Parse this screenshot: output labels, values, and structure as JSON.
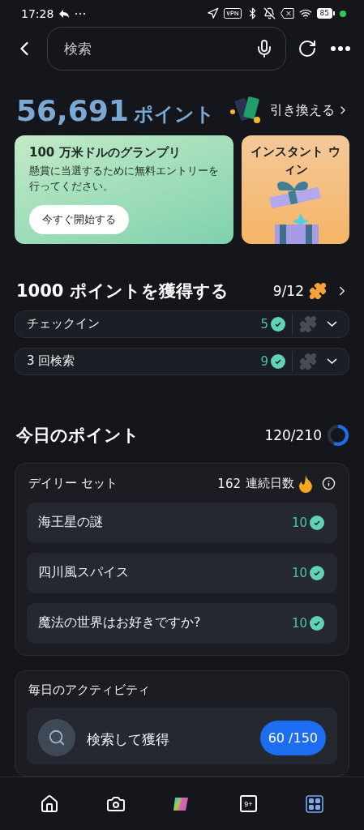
{
  "status_bar": {
    "time": "17:28",
    "battery": "85"
  },
  "search": {
    "placeholder": "検索"
  },
  "points": {
    "value": "56,691",
    "unit": "ポイント",
    "redeem": "引き換える"
  },
  "promos": [
    {
      "kind": "sweepstakes",
      "title": "100 万米ドルのグランプリ",
      "text": "懸賞に当選するために無料エントリーを行ってください。",
      "button": "今すぐ開始する"
    },
    {
      "kind": "instant",
      "title": "インスタント ウィン"
    }
  ],
  "goal": {
    "title": "1000 ポイントを獲得する",
    "progress": "9/12",
    "tasks": [
      {
        "label": "チェックイン",
        "count": "5",
        "completed": true,
        "expanded": false
      },
      {
        "label": "3 回検索",
        "count": "9",
        "completed": true,
        "expanded": false
      }
    ]
  },
  "today": {
    "title": "今日のポイント",
    "progress": "120/210",
    "daily_set": {
      "title": "デイリー セット",
      "streak": "162",
      "streak_label": "連続日数",
      "items": [
        {
          "label": "海王星の謎",
          "points": "10",
          "completed": true
        },
        {
          "label": "四川風スパイス",
          "points": "10",
          "completed": true
        },
        {
          "label": "魔法の世界はお好きですか?",
          "points": "10",
          "completed": true
        }
      ]
    }
  },
  "activities": {
    "title": "毎日のアクティビティ",
    "items": [
      {
        "label": "検索して獲得",
        "progress": "60 /150"
      }
    ]
  },
  "nav": [
    {
      "kind": "home",
      "selected": false
    },
    {
      "kind": "camera",
      "selected": false
    },
    {
      "kind": "copilot",
      "selected": false
    },
    {
      "kind": "tabs",
      "badge": "9+",
      "selected": false
    },
    {
      "kind": "apps",
      "selected": true
    }
  ]
}
